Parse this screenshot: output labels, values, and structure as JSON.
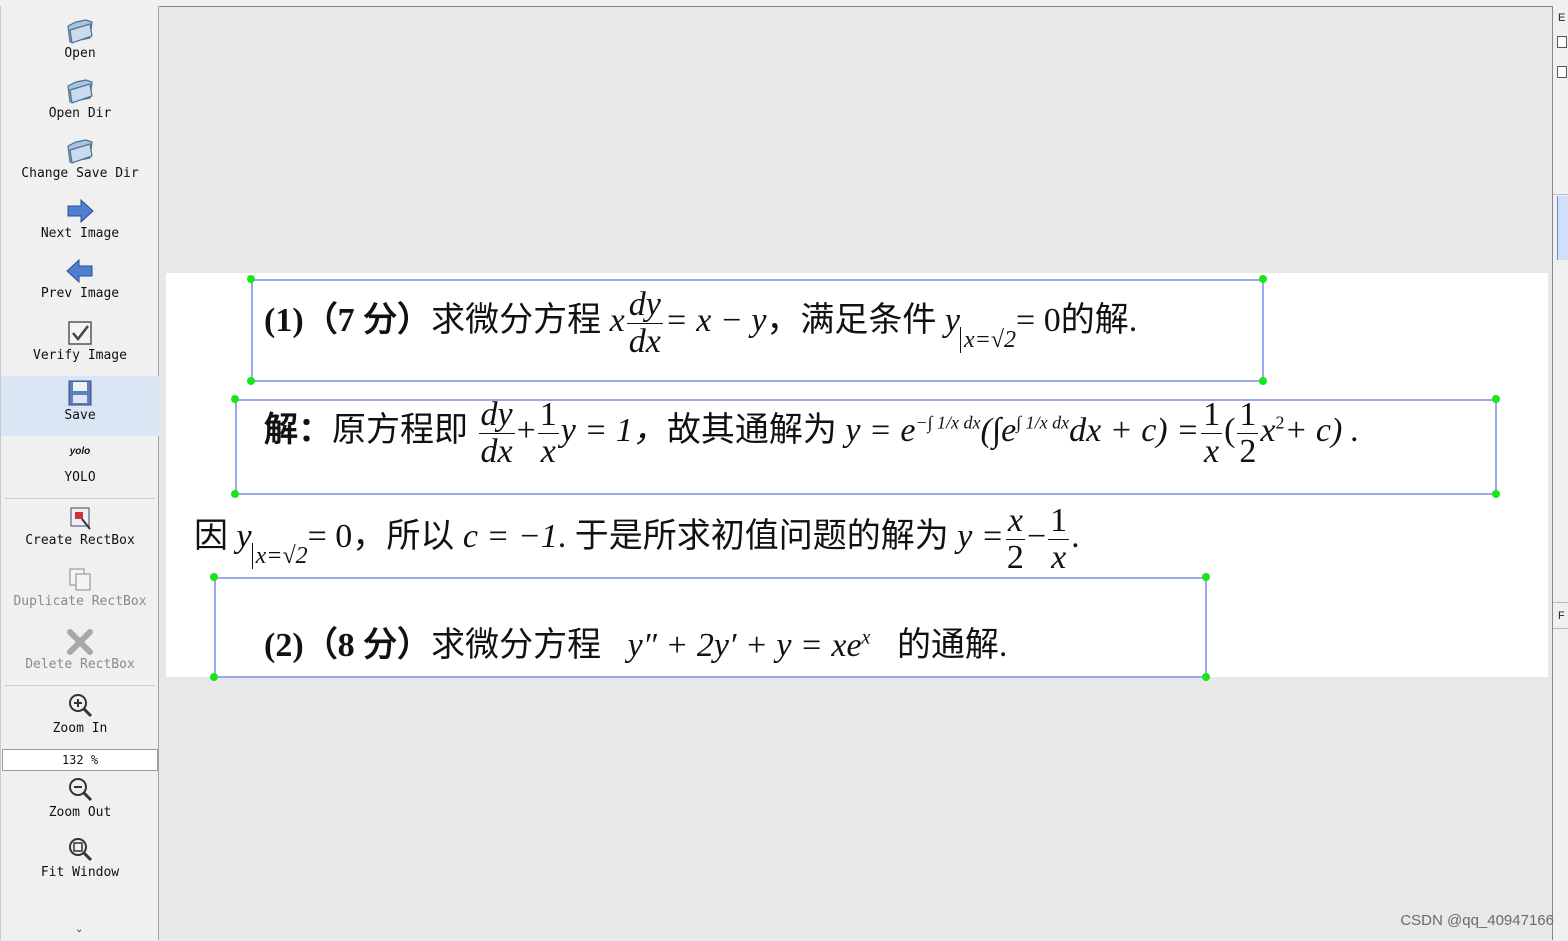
{
  "toolbar": {
    "open": "Open",
    "open_dir": "Open Dir",
    "change_save_dir": "Change Save Dir",
    "next_image": "Next Image",
    "prev_image": "Prev Image",
    "verify_image": "Verify Image",
    "save": "Save",
    "yolo_icon_text": "yolo",
    "yolo": "YOLO",
    "create_rectbox": "Create RectBox",
    "duplicate_rectbox": "Duplicate RectBox",
    "delete_rectbox": "Delete RectBox",
    "zoom_in": "Zoom In",
    "zoom_value": "132 %",
    "zoom_out": "Zoom Out",
    "fit_window": "Fit Window",
    "more": "⌄"
  },
  "document": {
    "line1": {
      "num": "(1)",
      "pts": "（7 分）",
      "text": "求微分方程",
      "x": "x",
      "dy": "dy",
      "dx": "dx",
      "eq": "= x − y",
      "cond": "，满足条件",
      "y": "y",
      "sub": "x=√2",
      "zero": "= 0",
      "tail": "的解."
    },
    "line2": {
      "jie": "解：",
      "text1": "原方程即",
      "dy": "dy",
      "dx": "dx",
      "plus": "+",
      "one": "1",
      "x": "x",
      "y_eq": "y = 1，",
      "text2": "故其通解为",
      "y_eq_e": "y = e",
      "exp1": "−∫ 1/x dx",
      "paren": "(∫e",
      "exp2": "∫ 1/x dx",
      "dxc": "dx + c) =",
      "one_b": "1",
      "x_b": "x",
      "lp": "(",
      "one_c": "1",
      "two": "2",
      "x2": "x",
      "sq": "2",
      "plus_c": "+ c) ."
    },
    "line3": {
      "yin": "因",
      "y": "y",
      "sub": "x=√2",
      "zero": "= 0，",
      "text1": "所以",
      "c": "c = −1",
      "text2": ". 于是所求初值问题的解为",
      "y_eq": "y =",
      "x": "x",
      "two": "2",
      "minus": "−",
      "one": "1",
      "x_b": "x",
      "dot": "."
    },
    "line4": {
      "num": "(2)",
      "pts": "（8 分）",
      "text": "求微分方程",
      "expr": "y″ + 2y′ + y = xe",
      "sup": "x",
      "tail": "的通解."
    }
  },
  "right_panel": {
    "letter_top": "E",
    "letter_bottom": "F"
  },
  "watermark": "CSDN @qq_40947166",
  "colors": {
    "bbox_border": "#9aa8f0",
    "handle": "#19e619",
    "toolbar_bg": "#f0f0f0",
    "canvas_bg": "#e8e8e8",
    "active_tool_bg": "#dbe6f4"
  }
}
